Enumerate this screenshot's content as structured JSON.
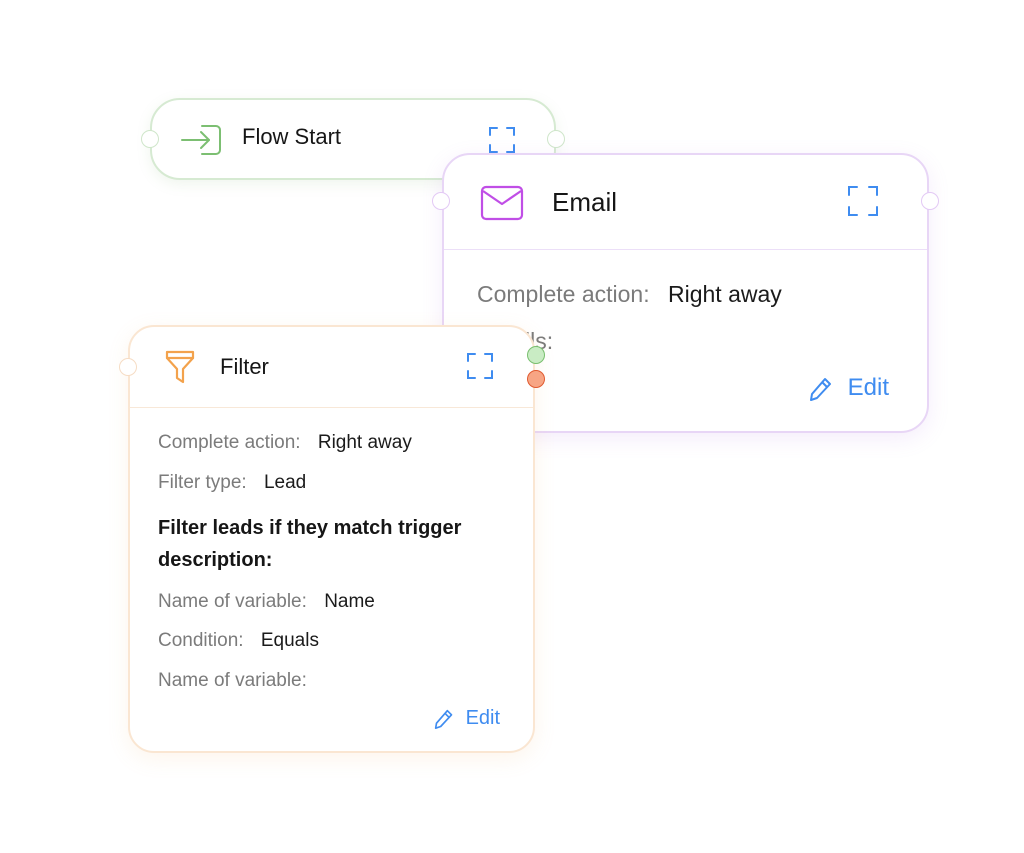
{
  "flow_start": {
    "title": "Flow Start",
    "icon": "enter-arrow-icon",
    "accent_color": "#7cbf72"
  },
  "email": {
    "title": "Email",
    "icon": "envelope-icon",
    "accent_color": "#c04ee6",
    "complete_action_label": "Complete action:",
    "complete_action_value": "Right away",
    "partial_label": "ils:",
    "edit_label": "Edit"
  },
  "filter": {
    "title": "Filter",
    "icon": "funnel-icon",
    "accent_color": "#f3a24c",
    "complete_action_label": "Complete action:",
    "complete_action_value": "Right away",
    "filter_type_label": "Filter type:",
    "filter_type_value": "Lead",
    "description": "Filter leads if they match trigger description:",
    "name_var_label": "Name of variable:",
    "name_var_value": "Name",
    "condition_label": "Condition:",
    "condition_value": "Equals",
    "name_var2_label": "Name of variable:",
    "edit_label": "Edit"
  },
  "ports": {
    "success_color": "#a6dba0",
    "failure_color": "#f4936e"
  },
  "link_color": "#3f8cf0"
}
